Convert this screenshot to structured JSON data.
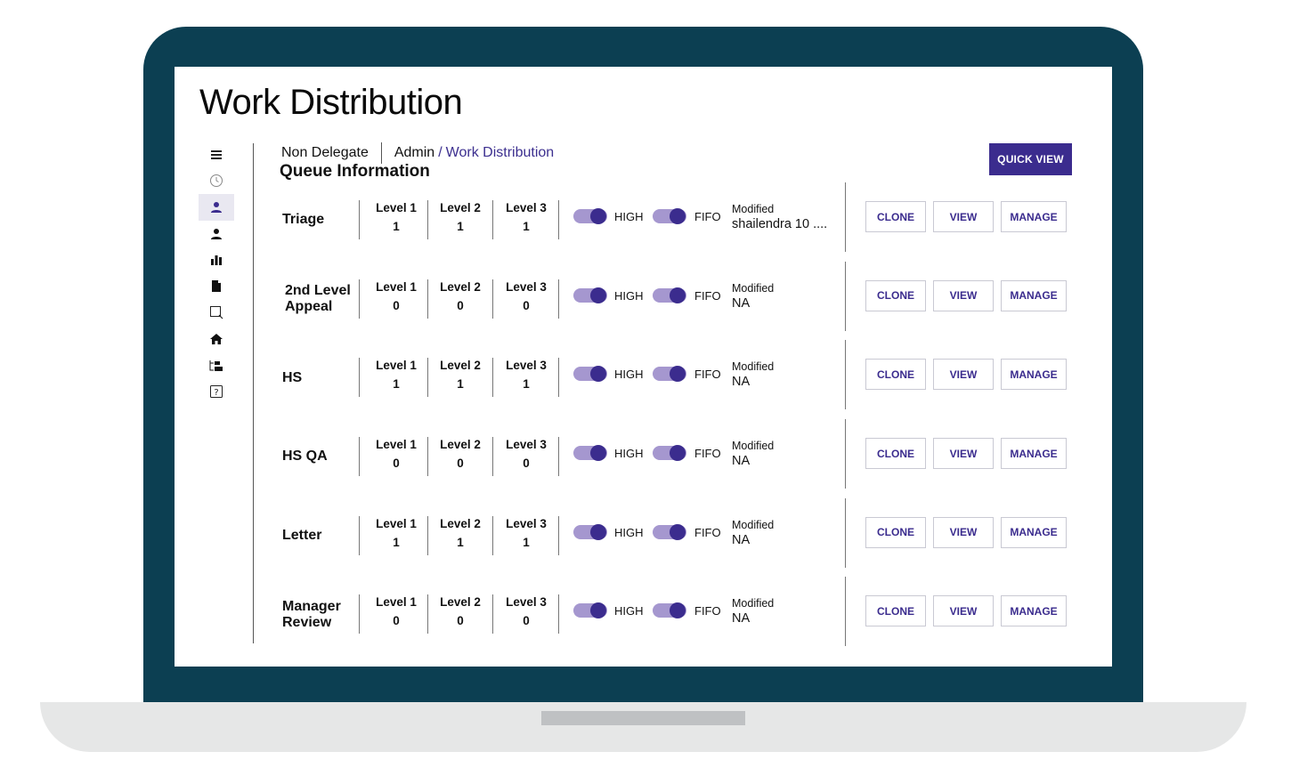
{
  "app": {
    "title": "Work Distribution"
  },
  "sidebar": {
    "items": [
      {
        "icon": "menu-icon",
        "active": false
      },
      {
        "icon": "clock-icon",
        "active": false
      },
      {
        "icon": "user-icon",
        "active": true
      },
      {
        "icon": "user-icon",
        "active": false
      },
      {
        "icon": "bar-chart-icon",
        "active": false
      },
      {
        "icon": "document-icon",
        "active": false
      },
      {
        "icon": "search-icon",
        "active": false
      },
      {
        "icon": "home-icon",
        "active": false
      },
      {
        "icon": "folder-tree-icon",
        "active": false
      },
      {
        "icon": "help-icon",
        "active": false
      }
    ]
  },
  "breadcrumb": {
    "root": "Non Delegate",
    "admin": "Admin",
    "separator": "/",
    "current": "Work Distribution"
  },
  "section": {
    "title": "Queue Information"
  },
  "quick_view_label": "QUICK VIEW",
  "labels": {
    "level1": "Level 1",
    "level2": "Level 2",
    "level3": "Level 3",
    "high": "HIGH",
    "fifo": "FIFO",
    "modified": "Modified",
    "clone": "CLONE",
    "view": "VIEW",
    "manage": "MANAGE"
  },
  "colors": {
    "accent": "#3b2c8e",
    "toggle_track": "#a597cf",
    "frame": "#0c3f52"
  },
  "queues": [
    {
      "name": "Triage",
      "l1": "1",
      "l2": "1",
      "l3": "1",
      "high_on": true,
      "fifo_on": true,
      "modified": "shailendra 10 ...."
    },
    {
      "name": "2nd Level Appeal",
      "l1": "0",
      "l2": "0",
      "l3": "0",
      "high_on": true,
      "fifo_on": true,
      "modified": "NA"
    },
    {
      "name": "HS",
      "l1": "1",
      "l2": "1",
      "l3": "1",
      "high_on": true,
      "fifo_on": true,
      "modified": "NA"
    },
    {
      "name": "HS QA",
      "l1": "0",
      "l2": "0",
      "l3": "0",
      "high_on": true,
      "fifo_on": true,
      "modified": "NA"
    },
    {
      "name": "Letter",
      "l1": "1",
      "l2": "1",
      "l3": "1",
      "high_on": true,
      "fifo_on": true,
      "modified": "NA"
    },
    {
      "name": "Manager Review",
      "l1": "0",
      "l2": "0",
      "l3": "0",
      "high_on": true,
      "fifo_on": true,
      "modified": "NA"
    }
  ]
}
